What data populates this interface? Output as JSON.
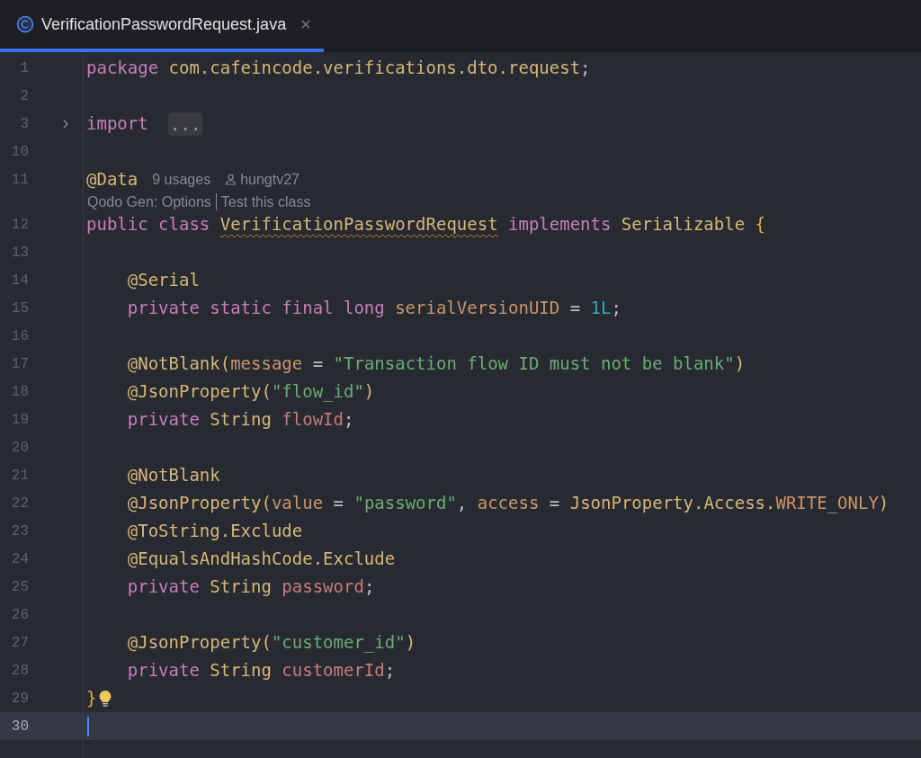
{
  "tabs": [
    {
      "title": "VerificationPasswordRequest.java",
      "selected": true
    }
  ],
  "lines": [
    {
      "number": "1",
      "foldable": false,
      "current": false,
      "bulb": false,
      "tokens": [
        {
          "kind": "keyword",
          "text": "package "
        },
        {
          "kind": "type",
          "text": "com.cafeincode.verifications.dto.request"
        },
        {
          "kind": "plain",
          "text": ";"
        }
      ]
    },
    {
      "number": "2",
      "foldable": false,
      "current": false,
      "bulb": false
    },
    {
      "number": "3",
      "foldable": true,
      "current": false,
      "bulb": false,
      "tokens": [
        {
          "kind": "keyword",
          "text": "import "
        }
      ],
      "folded": "..."
    },
    {
      "number": "10",
      "foldable": false,
      "current": false,
      "bulb": false
    },
    {
      "number": "11",
      "foldable": false,
      "current": false,
      "bulb": false,
      "tokens": [
        {
          "kind": "annotation",
          "text": "@Data"
        }
      ],
      "hints": [
        {
          "kind": "usages",
          "text": "9 usages"
        },
        {
          "kind": "author",
          "text": "hungtv27"
        }
      ],
      "code_vision": [
        "Qodo Gen: Options",
        "Test this class"
      ]
    },
    {
      "number": "12",
      "foldable": false,
      "current": false,
      "bulb": false,
      "tokens": [
        {
          "kind": "keyword",
          "text": "public class "
        },
        {
          "kind": "type",
          "text": "VerificationPasswordRequest",
          "warning": true
        },
        {
          "kind": "keyword",
          "text": " implements "
        },
        {
          "kind": "type",
          "text": "Serializable "
        },
        {
          "kind": "brace",
          "text": "{"
        }
      ]
    },
    {
      "number": "13",
      "foldable": false,
      "current": false,
      "bulb": false
    },
    {
      "number": "14",
      "foldable": false,
      "current": false,
      "bulb": false,
      "tokens": [
        {
          "kind": "annotation",
          "text": "    @Serial"
        }
      ]
    },
    {
      "number": "15",
      "foldable": false,
      "current": false,
      "bulb": false,
      "tokens": [
        {
          "kind": "keyword",
          "text": "    private static final long "
        },
        {
          "kind": "param",
          "text": "serialVersionUID"
        },
        {
          "kind": "plain",
          "text": " = "
        },
        {
          "kind": "number",
          "text": "1L"
        },
        {
          "kind": "plain",
          "text": ";"
        }
      ]
    },
    {
      "number": "16",
      "foldable": false,
      "current": false,
      "bulb": false
    },
    {
      "number": "17",
      "foldable": false,
      "current": false,
      "bulb": false,
      "tokens": [
        {
          "kind": "annotation",
          "text": "    @NotBlank("
        },
        {
          "kind": "param",
          "text": "message"
        },
        {
          "kind": "plain",
          "text": " = "
        },
        {
          "kind": "string",
          "text": "\"Transaction flow ID must not be blank\""
        },
        {
          "kind": "annotation",
          "text": ")"
        }
      ]
    },
    {
      "number": "18",
      "foldable": false,
      "current": false,
      "bulb": false,
      "tokens": [
        {
          "kind": "annotation",
          "text": "    @JsonProperty("
        },
        {
          "kind": "string",
          "text": "\"flow_id\""
        },
        {
          "kind": "annotation",
          "text": ")"
        }
      ]
    },
    {
      "number": "19",
      "foldable": false,
      "current": false,
      "bulb": false,
      "tokens": [
        {
          "kind": "keyword",
          "text": "    private "
        },
        {
          "kind": "type",
          "text": "String "
        },
        {
          "kind": "field",
          "text": "flowId"
        },
        {
          "kind": "plain",
          "text": ";"
        }
      ]
    },
    {
      "number": "20",
      "foldable": false,
      "current": false,
      "bulb": false
    },
    {
      "number": "21",
      "foldable": false,
      "current": false,
      "bulb": false,
      "tokens": [
        {
          "kind": "annotation",
          "text": "    @NotBlank"
        }
      ]
    },
    {
      "number": "22",
      "foldable": false,
      "current": false,
      "bulb": false,
      "tokens": [
        {
          "kind": "annotation",
          "text": "    @JsonProperty("
        },
        {
          "kind": "param",
          "text": "value"
        },
        {
          "kind": "plain",
          "text": " = "
        },
        {
          "kind": "string",
          "text": "\"password\""
        },
        {
          "kind": "plain",
          "text": ", "
        },
        {
          "kind": "param",
          "text": "access"
        },
        {
          "kind": "plain",
          "text": " = "
        },
        {
          "kind": "type",
          "text": "JsonProperty.Access."
        },
        {
          "kind": "param",
          "text": "WRITE_ONLY"
        },
        {
          "kind": "annotation",
          "text": ")"
        }
      ]
    },
    {
      "number": "23",
      "foldable": false,
      "current": false,
      "bulb": false,
      "tokens": [
        {
          "kind": "annotation",
          "text": "    @ToString.Exclude"
        }
      ]
    },
    {
      "number": "24",
      "foldable": false,
      "current": false,
      "bulb": false,
      "tokens": [
        {
          "kind": "annotation",
          "text": "    @EqualsAndHashCode.Exclude"
        }
      ]
    },
    {
      "number": "25",
      "foldable": false,
      "current": false,
      "bulb": false,
      "tokens": [
        {
          "kind": "keyword",
          "text": "    private "
        },
        {
          "kind": "type",
          "text": "String "
        },
        {
          "kind": "field",
          "text": "password"
        },
        {
          "kind": "plain",
          "text": ";"
        }
      ]
    },
    {
      "number": "26",
      "foldable": false,
      "current": false,
      "bulb": false
    },
    {
      "number": "27",
      "foldable": false,
      "current": false,
      "bulb": false,
      "tokens": [
        {
          "kind": "annotation",
          "text": "    @JsonProperty("
        },
        {
          "kind": "string",
          "text": "\"customer_id\""
        },
        {
          "kind": "annotation",
          "text": ")"
        }
      ]
    },
    {
      "number": "28",
      "foldable": false,
      "current": false,
      "bulb": false,
      "tokens": [
        {
          "kind": "keyword",
          "text": "    private "
        },
        {
          "kind": "type",
          "text": "String "
        },
        {
          "kind": "field",
          "text": "customerId"
        },
        {
          "kind": "plain",
          "text": ";"
        }
      ]
    },
    {
      "number": "29",
      "foldable": false,
      "current": false,
      "bulb": true,
      "tokens": [
        {
          "kind": "brace",
          "text": "}"
        }
      ]
    },
    {
      "number": "30",
      "foldable": false,
      "current": true,
      "bulb": false
    }
  ]
}
